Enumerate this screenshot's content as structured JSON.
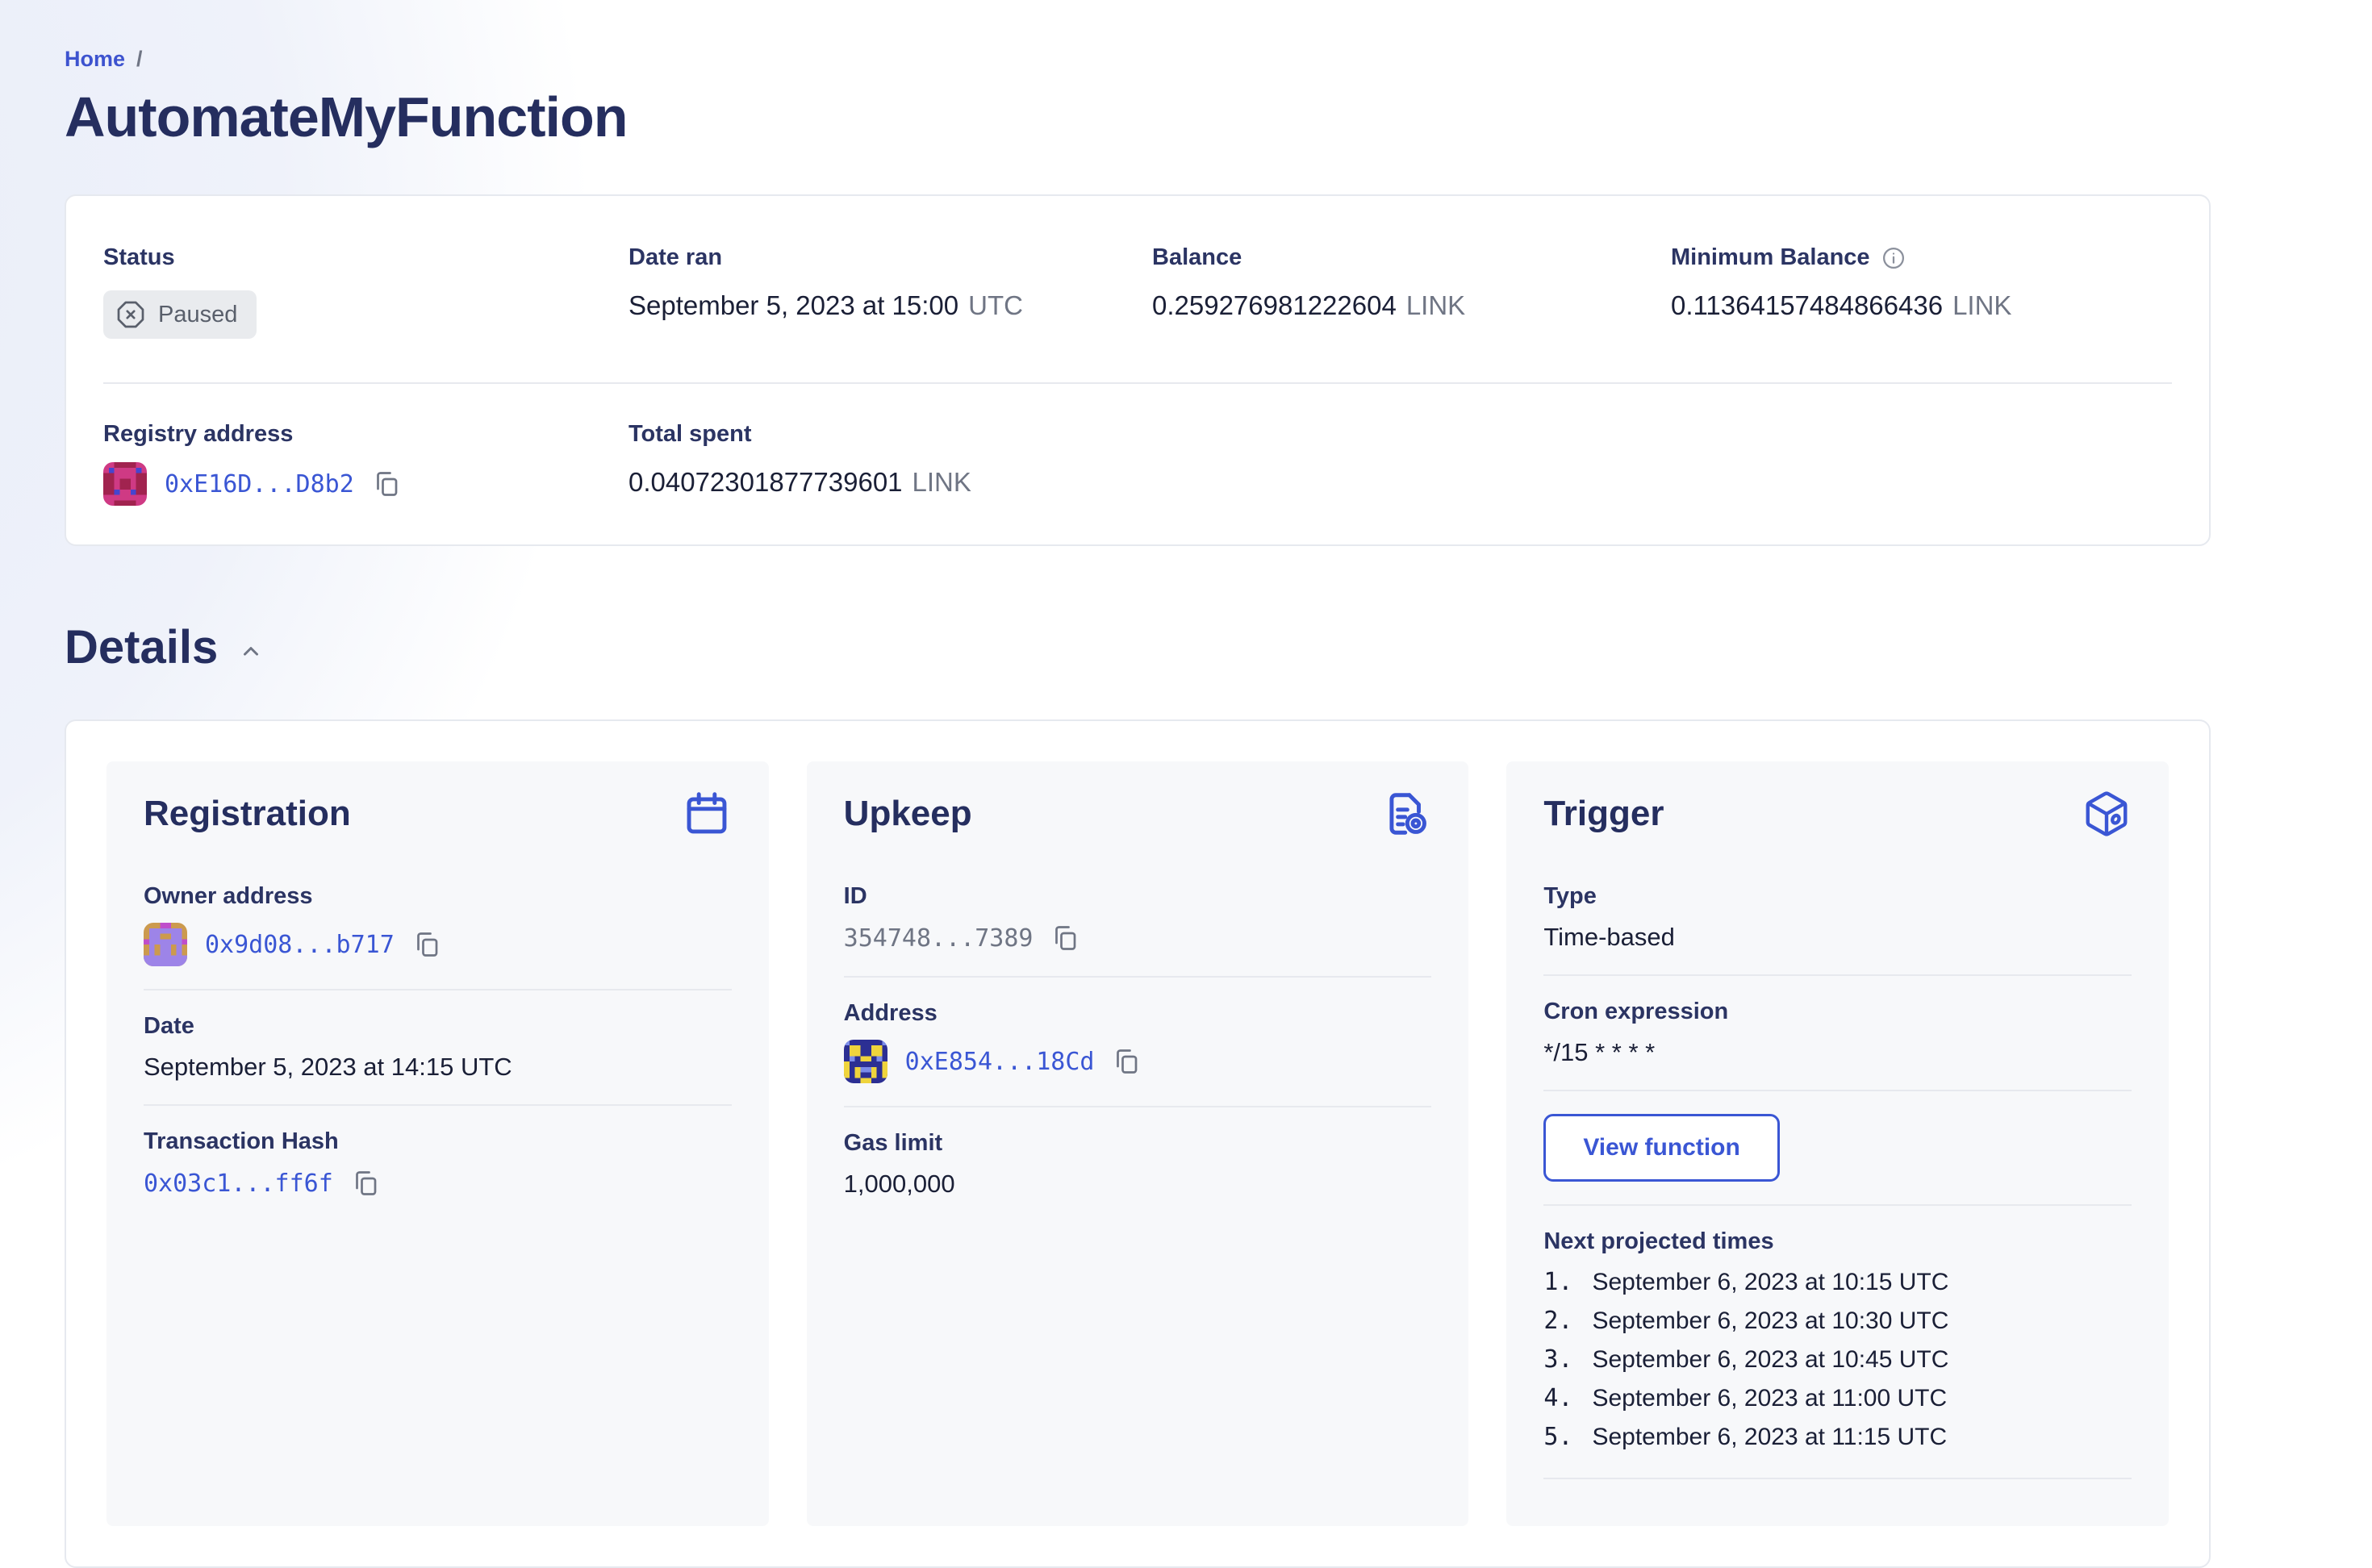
{
  "colors": {
    "accent_blue": "#3A56D4",
    "navy_heading": "#252E5F",
    "text_dark": "#1A1F36",
    "text_muted": "#6F7584",
    "badge_bg": "#E9EBEE",
    "inner_card_bg": "#F7F8FA",
    "border": "#E6E9EF"
  },
  "icons": {
    "paused": "octagon-x-icon",
    "info": "info-icon",
    "copy": "copy-icon",
    "registration": "calendar-icon",
    "upkeep": "document-search-icon",
    "trigger": "cube-icon",
    "details_collapse": "chevron-up-icon"
  },
  "breadcrumb": {
    "home": "Home",
    "separator": "/"
  },
  "page_title": "AutomateMyFunction",
  "summary": {
    "status": {
      "label": "Status",
      "value": "Paused"
    },
    "date_ran": {
      "label": "Date ran",
      "value": "September 5, 2023 at 15:00",
      "suffix": "UTC"
    },
    "balance": {
      "label": "Balance",
      "value": "0.259276981222604",
      "suffix": "LINK"
    },
    "min_balance": {
      "label": "Minimum Balance",
      "value": "0.11364157484866436",
      "suffix": "LINK"
    },
    "registry": {
      "label": "Registry address",
      "value": "0xE16D...D8b2"
    },
    "total_spent": {
      "label": "Total spent",
      "value": "0.04072301877739601",
      "suffix": "LINK"
    }
  },
  "details": {
    "title": "Details",
    "registration": {
      "title": "Registration",
      "owner": {
        "label": "Owner address",
        "value": "0x9d08...b717"
      },
      "date": {
        "label": "Date",
        "value": "September 5, 2023 at 14:15 UTC"
      },
      "tx": {
        "label": "Transaction Hash",
        "value": "0x03c1...ff6f"
      }
    },
    "upkeep": {
      "title": "Upkeep",
      "id": {
        "label": "ID",
        "value": "354748...7389"
      },
      "address": {
        "label": "Address",
        "value": "0xE854...18Cd"
      },
      "gas": {
        "label": "Gas limit",
        "value": "1,000,000"
      }
    },
    "trigger": {
      "title": "Trigger",
      "type": {
        "label": "Type",
        "value": "Time-based"
      },
      "cron": {
        "label": "Cron expression",
        "value": "*/15 * * * *"
      },
      "view_function_label": "View function",
      "next_times": {
        "label": "Next projected times",
        "items": [
          {
            "num": "1.",
            "text": "September 6, 2023 at 10:15 UTC"
          },
          {
            "num": "2.",
            "text": "September 6, 2023 at 10:30 UTC"
          },
          {
            "num": "3.",
            "text": "September 6, 2023 at 10:45 UTC"
          },
          {
            "num": "4.",
            "text": "September 6, 2023 at 11:00 UTC"
          },
          {
            "num": "5.",
            "text": "September 6, 2023 at 11:15 UTC"
          }
        ]
      }
    }
  }
}
